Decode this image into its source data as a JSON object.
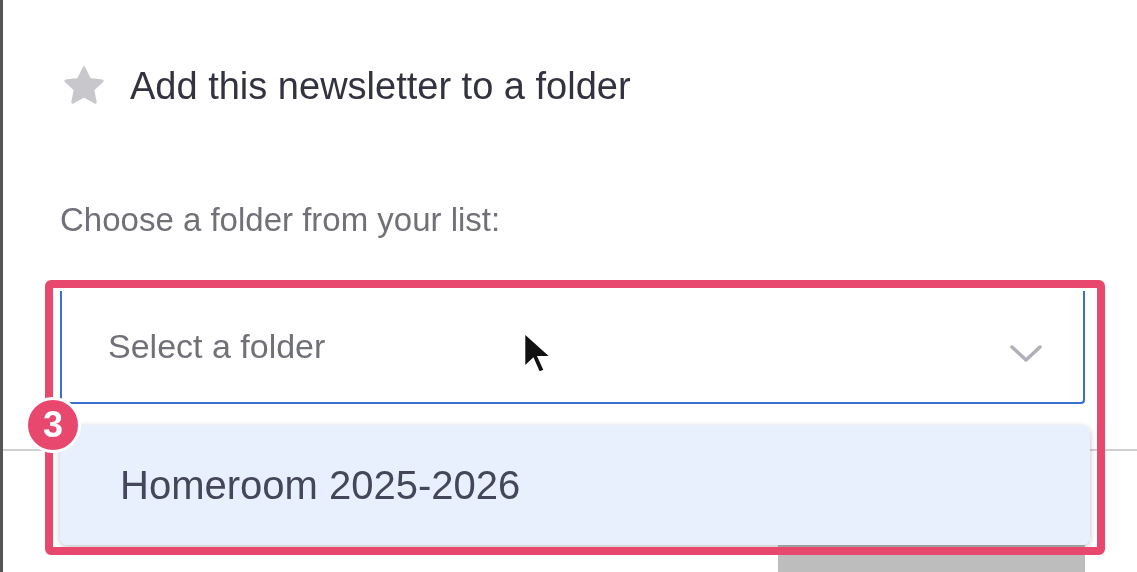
{
  "dialog": {
    "title": "Add this newsletter to a folder",
    "label": "Choose a folder from your list:",
    "select": {
      "placeholder": "Select a folder",
      "expanded": true
    },
    "options": [
      {
        "label": "Homeroom 2025-2026",
        "selected": true
      }
    ],
    "buttons": [
      {
        "kind": "primary",
        "disabled": true
      }
    ]
  },
  "annotation": {
    "badge": "3"
  }
}
